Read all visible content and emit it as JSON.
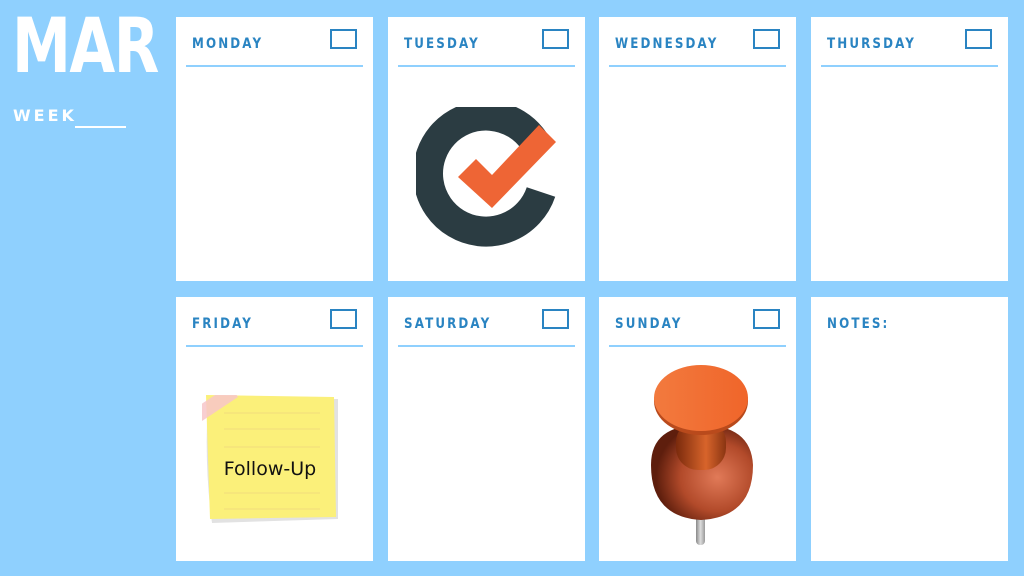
{
  "header": {
    "month": "MAR",
    "week_label": "WEEK"
  },
  "days": [
    {
      "label": "MONDAY"
    },
    {
      "label": "TUESDAY"
    },
    {
      "label": "WEDNESDAY"
    },
    {
      "label": "THURSDAY"
    },
    {
      "label": "FRIDAY"
    },
    {
      "label": "SATURDAY"
    },
    {
      "label": "SUNDAY"
    }
  ],
  "notes": {
    "label": "NOTES:"
  },
  "sticky_note": {
    "text": "Follow-Up"
  },
  "icons": {
    "tuesday": "checkmark-circle-icon",
    "friday": "sticky-note-icon",
    "sunday": "push-pin-icon"
  },
  "colors": {
    "background": "#8fd0fe",
    "accent": "#2a84c2",
    "check_orange": "#ee6535",
    "ring_dark": "#2b3c42"
  }
}
